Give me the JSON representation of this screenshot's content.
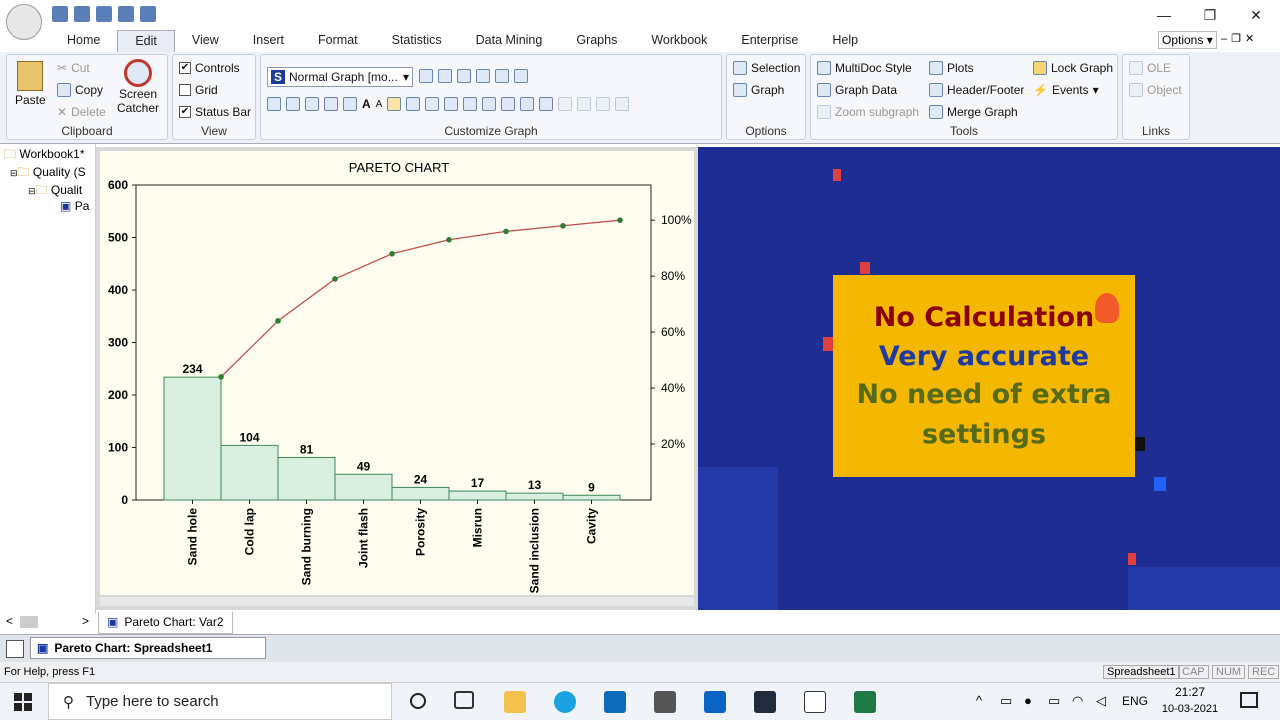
{
  "window": {
    "minimize": "—",
    "restore": "❐",
    "close": "✕"
  },
  "tabs": [
    "Home",
    "Edit",
    "View",
    "Insert",
    "Format",
    "Statistics",
    "Data Mining",
    "Graphs",
    "Workbook",
    "Enterprise",
    "Help"
  ],
  "options_label": "Options",
  "ribbon": {
    "clipboard": {
      "paste": "Paste",
      "cut": "Cut",
      "copy": "Copy",
      "delete": "Delete",
      "screen": "Screen",
      "catcher": "Catcher",
      "label": "Clipboard"
    },
    "view": {
      "controls": "Controls",
      "grid": "Grid",
      "status_bar": "Status Bar",
      "label": "View"
    },
    "customize": {
      "graph_type": "Normal Graph [mo...",
      "label": "Customize Graph"
    },
    "options": {
      "selection": "Selection",
      "graph": "Graph",
      "label": "Options"
    },
    "tools": {
      "multidoc": "MultiDoc Style",
      "plots": "Plots",
      "lock": "Lock Graph",
      "graph_data": "Graph Data",
      "header_footer": "Header/Footer",
      "events": "Events",
      "zoom_subgraph": "Zoom subgraph",
      "merge": "Merge Graph",
      "label": "Tools"
    },
    "links": {
      "ole": "OLE",
      "object": "Object",
      "label": "Links"
    }
  },
  "tree": {
    "workbook": "Workbook1*",
    "quality1": "Quality (S",
    "quality2": "Qualit",
    "pa": "Pa"
  },
  "chart_data": {
    "type": "bar",
    "title": "PARETO CHART",
    "categories": [
      "Sand hole",
      "Cold lap",
      "Sand burning",
      "Joint flash",
      "Porosity",
      "Misrun",
      "Sand inclusion",
      "Cavity"
    ],
    "values": [
      234,
      104,
      81,
      49,
      24,
      17,
      13,
      9
    ],
    "cumulative_percent": [
      44,
      64,
      79,
      88,
      93,
      96,
      98,
      100
    ],
    "ylim": [
      0,
      600
    ],
    "yticks": [
      "0",
      "100",
      "200",
      "300",
      "400",
      "500",
      "600"
    ],
    "y2ticks": [
      "20%",
      "40%",
      "60%",
      "80%",
      "100%"
    ],
    "bar_color": "#d9efe0",
    "line_color": "#c0504d",
    "marker_color": "#2e7d32"
  },
  "overlay": {
    "line1": "No Calculation",
    "line2": "Very accurate",
    "line3": "No need of extra",
    "line4": "settings"
  },
  "bottom_tab": "Pareto Chart: Var2",
  "mdi_item": "Pareto Chart: Spreadsheet1",
  "status": {
    "help": "For Help, press F1",
    "sheet": "Spreadsheet1",
    "cap": "CAP",
    "num": "NUM",
    "rec": "REC"
  },
  "taskbar": {
    "search": "Type here to search",
    "lang": "ENG",
    "time": "21:27",
    "date": "10-03-2021"
  }
}
